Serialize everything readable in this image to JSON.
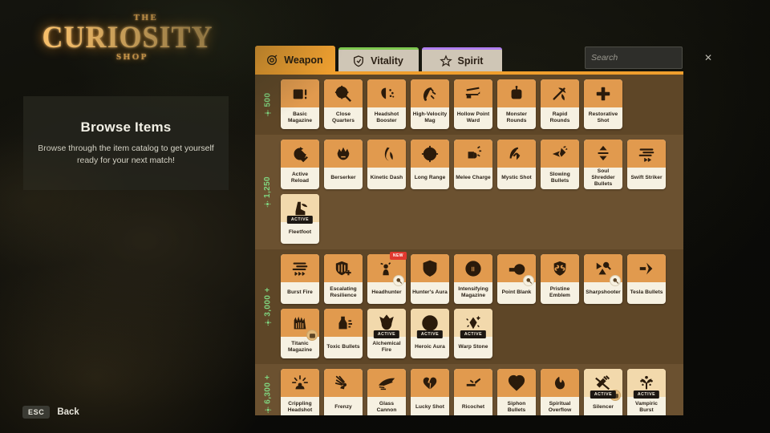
{
  "logo": {
    "the": "THE",
    "main": "CURIOSITY",
    "shop": "SHOP"
  },
  "info_panel": {
    "title": "Browse Items",
    "description": "Browse through the item catalog to get yourself ready for your next match!"
  },
  "footer": {
    "key": "ESC",
    "label": "Back"
  },
  "search": {
    "placeholder": "Search",
    "value": "",
    "clear_label": "✕"
  },
  "colors": {
    "accent_orange": "#f0a030",
    "tab_vitality": "#7ec850",
    "tab_spirit": "#b07ff0",
    "souls_green": "#7fd47f",
    "new_red": "#e2392f",
    "panel_brown": "#5a4326",
    "card_cream": "#f6f1e2"
  },
  "tabs": [
    {
      "label": "Weapon",
      "icon": "weapon-icon",
      "active": true,
      "accent": "#f0a030"
    },
    {
      "label": "Vitality",
      "icon": "vitality-icon",
      "active": false,
      "accent": "#7ec850"
    },
    {
      "label": "Spirit",
      "icon": "spirit-icon",
      "active": false,
      "accent": "#b07ff0"
    }
  ],
  "tiers": [
    {
      "price": "500",
      "items": [
        {
          "name": "Basic Magazine",
          "icon": "magazine-icon"
        },
        {
          "name": "Close Quarters",
          "icon": "scope-target-icon"
        },
        {
          "name": "Headshot Booster",
          "icon": "head-burst-icon"
        },
        {
          "name": "High-Velocity Mag",
          "icon": "magnet-icon"
        },
        {
          "name": "Hollow Point Ward",
          "icon": "gun-shield-icon"
        },
        {
          "name": "Monster Rounds",
          "icon": "robot-icon"
        },
        {
          "name": "Rapid Rounds",
          "icon": "pickaxe-icon"
        },
        {
          "name": "Restorative Shot",
          "icon": "cross-icon"
        }
      ]
    },
    {
      "price": "1,250",
      "items": [
        {
          "name": "Active Reload",
          "icon": "reload-check-icon"
        },
        {
          "name": "Berserker",
          "icon": "berserk-skull-icon"
        },
        {
          "name": "Kinetic Dash",
          "icon": "dash-swoosh-icon"
        },
        {
          "name": "Long Range",
          "icon": "crosshair-icon"
        },
        {
          "name": "Melee Charge",
          "icon": "fist-charge-icon"
        },
        {
          "name": "Mystic Shot",
          "icon": "arrow-arc-icon"
        },
        {
          "name": "Slowing Bullets",
          "icon": "slow-bolt-icon"
        },
        {
          "name": "Soul Shredder Bullets",
          "icon": "up-down-arrows-icon"
        },
        {
          "name": "Swift Striker",
          "icon": "speed-lines-icon"
        },
        {
          "name": "Fleetfoot",
          "icon": "winged-boot-icon",
          "active": true
        }
      ]
    },
    {
      "price": "3,000 +",
      "items": [
        {
          "name": "Burst Fire",
          "icon": "burst-lines-icon"
        },
        {
          "name": "Escalating Resilience",
          "icon": "shield-plus-icon"
        },
        {
          "name": "Headhunter",
          "icon": "hunter-target-icon",
          "new": true,
          "component": true
        },
        {
          "name": "Hunter's Aura",
          "icon": "shield-down-icon"
        },
        {
          "name": "Intensifying Magazine",
          "icon": "mag-circle-icon"
        },
        {
          "name": "Point Blank",
          "icon": "point-blank-icon",
          "component": true
        },
        {
          "name": "Pristine Emblem",
          "icon": "emblem-icon"
        },
        {
          "name": "Sharpshooter",
          "icon": "sharpshooter-icon",
          "component": true
        },
        {
          "name": "Tesla Bullets",
          "icon": "tesla-bolt-icon"
        },
        {
          "name": "Titanic Magazine",
          "icon": "titanic-mag-icon",
          "component": true,
          "component_dark": true
        },
        {
          "name": "Toxic Bullets",
          "icon": "toxic-bottle-icon"
        },
        {
          "name": "Alchemical Fire",
          "icon": "alchemy-flask-icon",
          "active": true
        },
        {
          "name": "Heroic Aura",
          "icon": "heroic-coin-icon",
          "active": true
        },
        {
          "name": "Warp Stone",
          "icon": "warp-stone-icon",
          "active": true
        }
      ]
    },
    {
      "price": "6,300 +",
      "items": [
        {
          "name": "Crippling Headshot",
          "icon": "crippling-icon"
        },
        {
          "name": "Frenzy",
          "icon": "frenzy-icon"
        },
        {
          "name": "Glass Cannon",
          "icon": "glass-cannon-icon"
        },
        {
          "name": "Lucky Shot",
          "icon": "broken-heart-icon"
        },
        {
          "name": "Ricochet",
          "icon": "ricochet-icon"
        },
        {
          "name": "Siphon Bullets",
          "icon": "heart-rings-icon"
        },
        {
          "name": "Spiritual Overflow",
          "icon": "spirit-flame-icon"
        },
        {
          "name": "Silencer",
          "icon": "silencer-icon",
          "active": true,
          "component": true,
          "component_dark": true
        },
        {
          "name": "Vampiric Burst",
          "icon": "vampiric-icon",
          "active": true
        }
      ]
    }
  ]
}
